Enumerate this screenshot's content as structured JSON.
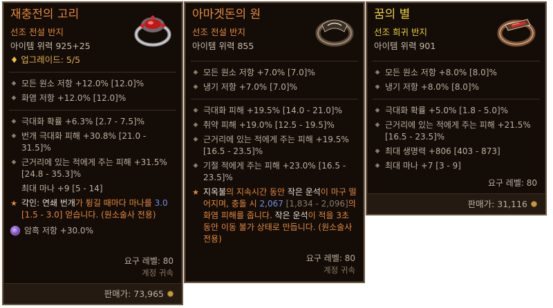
{
  "cards": [
    {
      "title": "재충전의 고리",
      "subtitle": "선조 전설 반지",
      "power": "아이템 위력 925+25",
      "upgrade": "업그레이드: 5/5",
      "resists": [
        "모든 원소 저항 +12.0% [12.0]%",
        "화염 저항 +12.0% [12.0]%"
      ],
      "stats": [
        "극대화 확률 +6.3% [2.7 - 7.5]%",
        "번개 극대화 피해 +30.8% [21.0 - 31.5]%",
        "근거리에 있는 적에게 주는 피해 +31.5% [24.8 - 35.3]%"
      ],
      "extra_stat": "최대 마나 +9 [5 - 14]",
      "aspect": {
        "p1": "각인: ",
        "p2": "연쇄 번개",
        "p3": "가 튕길 때마다 마나를 ",
        "p4": "3.0",
        "p5": " [1.5 - 3.0] 얻습니다. (원소술사 전용)"
      },
      "socket": "암흑 저항 +30.0%",
      "req": "요구 레벨: 80",
      "bound": "계정 귀속",
      "sell_label": "판매가: ",
      "sell_value": "73,965"
    },
    {
      "title": "아마겟돈의 원",
      "subtitle": "선조 전설 반지",
      "power": "아이템 위력 855",
      "resists": [
        "모든 원소 저항 +7.0% [7.0]%",
        "냉기 저항 +7.0% [7.0]%"
      ],
      "stats": [
        "극대화 피해 +19.5% [14.0 - 21.0]%",
        "취약 피해 +19.0% [12.5 - 19.5]%",
        "근거리에 있는 적에게 주는 피해 +19.5% [16.5 - 23.5]%",
        "기절 적에게 주는 피해 +23.0% [16.5 - 23.5]%"
      ],
      "aspect": {
        "p1": "지옥불",
        "p2": "의 지속시간 동안 ",
        "p3": "작은 운석",
        "p4": "이 마구 떨어지며, 충돌 시 ",
        "p5": "2,067",
        "p6": " [1,834 - 2,096]",
        "p7": "의 화염 피해를 줍니다. ",
        "p8": "작은 운석",
        "p9": "이 적을 3초 동안 이동 불가 상태로 만듭니다. (원소술사 전용)"
      },
      "req": "요구 레벨: 80",
      "bound": "계정 귀속"
    },
    {
      "title": "꿈의 별",
      "subtitle": "선조 희귀 반지",
      "power": "아이템 위력 901",
      "resists": [
        "모든 원소 저항 +8.0% [8.0]%",
        "냉기 저항 +8.0% [8.0]%"
      ],
      "stats": [
        "극대화 확률 +5.0% [1.8 - 5.0]%",
        "근거리에 있는 적에게 주는 피해 +21.5% [16.5 - 23.5]%",
        "최대 생명력 +806 [403 - 873]",
        "최대 마나 +7 [3 - 9]"
      ],
      "req": "요구 레벨: 80",
      "sell_label": "판매가: ",
      "sell_value": "31,116"
    }
  ],
  "icons": [
    "ring-ruby-icon",
    "ring-bronze-band-icon",
    "ring-red-gem-icon",
    "coin-icon",
    "socket-gem-icon"
  ],
  "colors": {
    "legendary": "#e48a3c",
    "rare": "#e8d23c",
    "border": "#6b5842"
  }
}
